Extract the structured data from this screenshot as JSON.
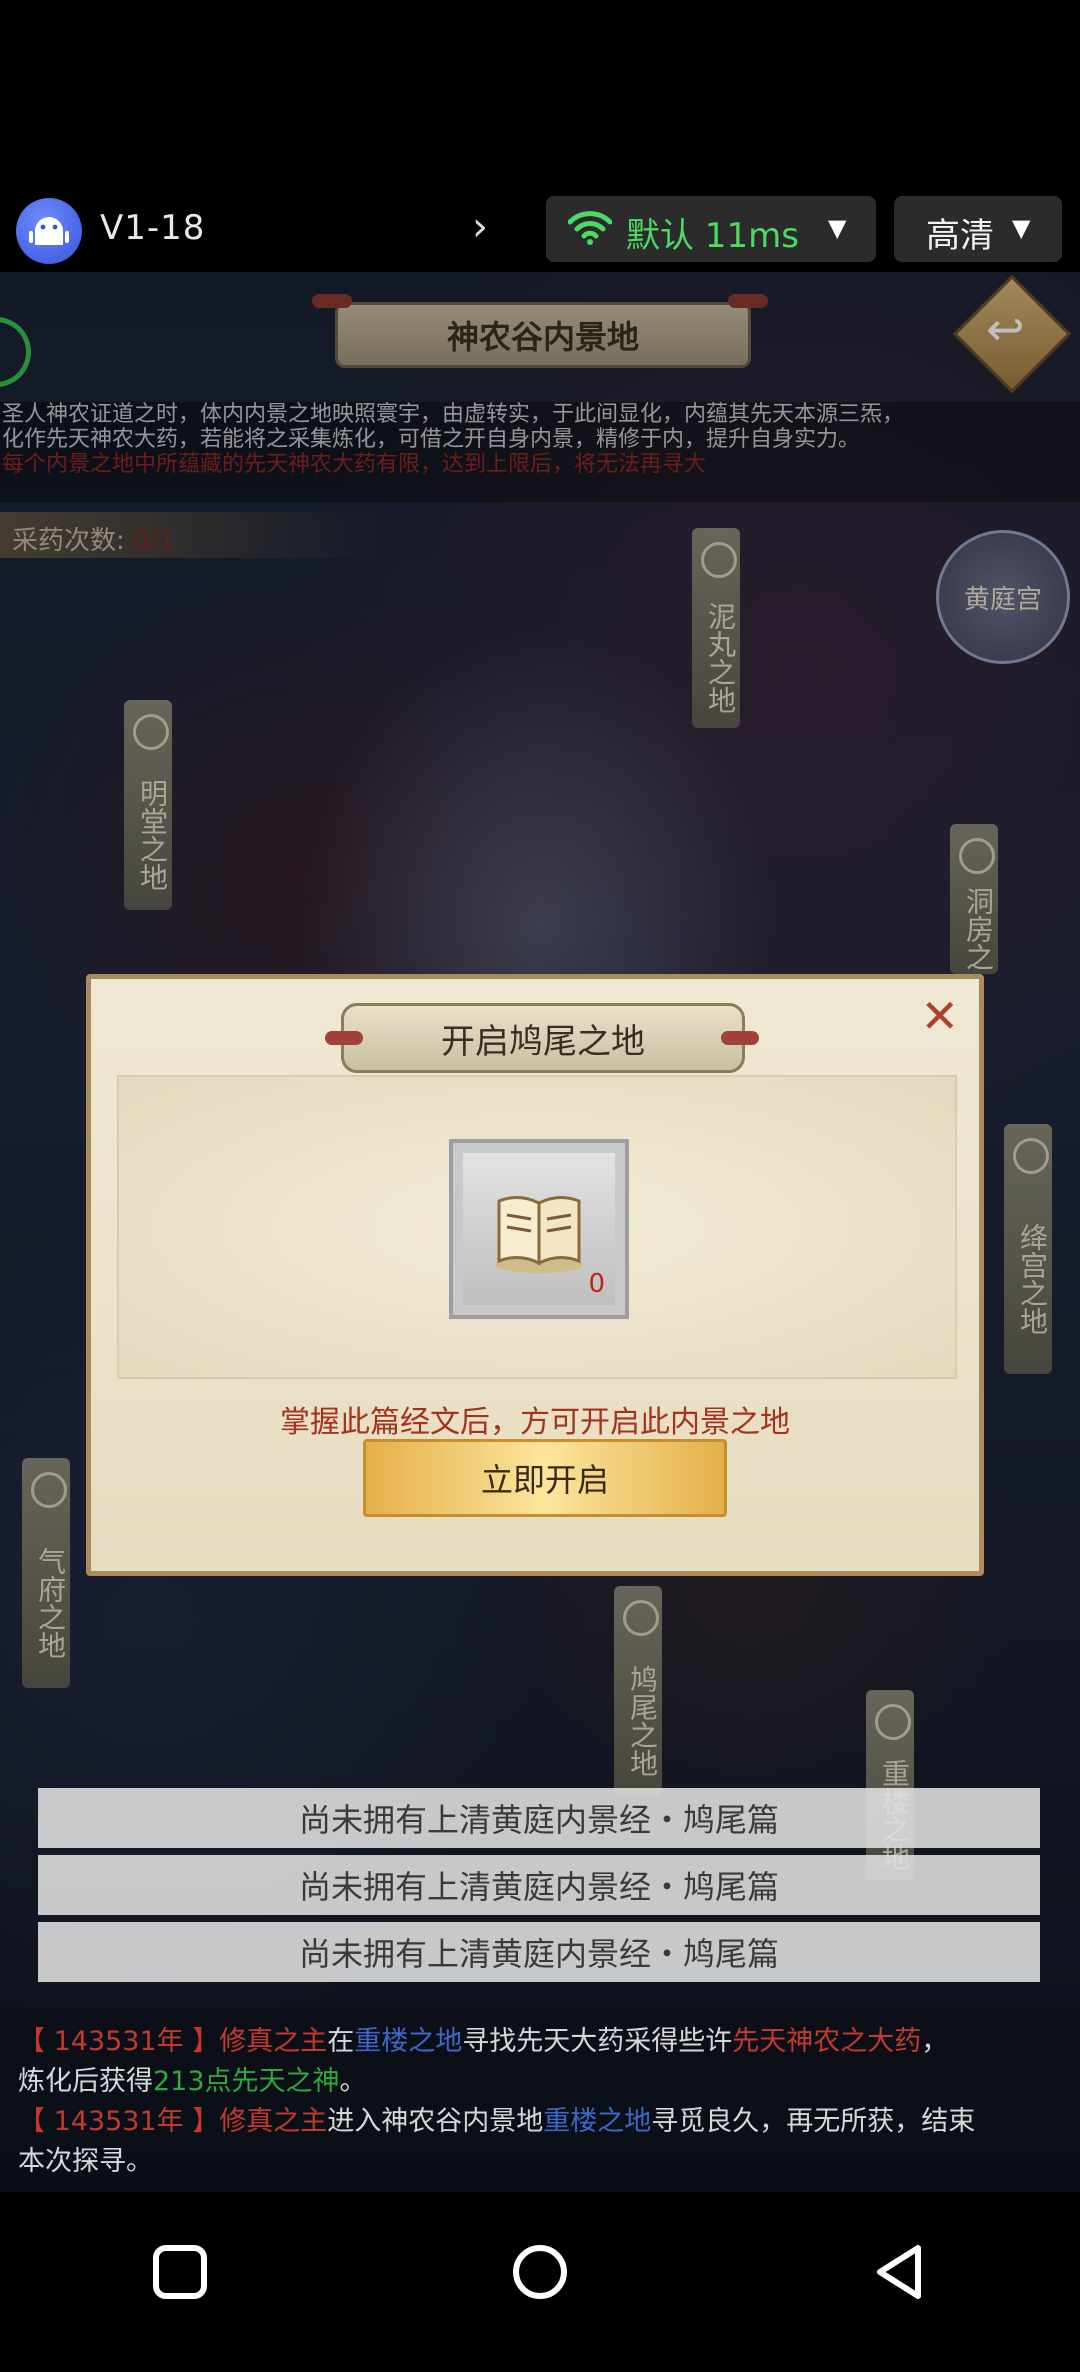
{
  "remote_bar": {
    "device_name": "V1-18",
    "network_label": "默认 11ms",
    "quality_label": "高清",
    "accent_green": "#4cd964"
  },
  "game": {
    "title": "神农谷内景地",
    "intro_lines": [
      "圣人神农证道之时，体内内景之地映照寰宇，由虚转实，于此间显化，内蕴其先天本源三炁，",
      "化作先天神农大药，若能将之采集炼化，可借之开自身内景，精修于内，提升自身实力。",
      "每个内景之地中所蕴藏的先天神农大药有限，达到上限后，将无法再寻大"
    ],
    "herb_count_label": "采药次数:",
    "herb_count_value": "0/1",
    "nodes": {
      "niwan": "泥丸之地",
      "huangting": "黄庭宫",
      "mingtang": "明堂之地",
      "dongfang": "洞房之",
      "jianggong": "绛宫之地",
      "qifu": "气府之地",
      "jiuwei": "鸠尾之地",
      "chonglou": "重楼之地"
    },
    "status_rows": [
      "尚未拥有上清黄庭内景经・鸠尾篇",
      "尚未拥有上清黄庭内景经・鸠尾篇",
      "尚未拥有上清黄庭内景经・鸠尾篇"
    ],
    "log": {
      "l1_year": "【 143531年 】",
      "l1_who": "修真之主",
      "l1_t1": "在",
      "l1_place": "重楼之地",
      "l1_t2": "寻找先天大药采得些许",
      "l1_item": "先天神农之大药",
      "l1_t3": "，",
      "l1_t4": "炼化后获得",
      "l1_gain": "213点先天之神",
      "l1_t5": "。",
      "l2_year": "【 143531年 】",
      "l2_who": "修真之主",
      "l2_t1": "进入神农谷内景地",
      "l2_place": "重楼之地",
      "l2_t2": "寻觅良久，再无所获，结束",
      "l2_t3": "本次探寻。"
    }
  },
  "dialog": {
    "title": "开启鸠尾之地",
    "item_count": "0",
    "hint": "掌握此篇经文后，方可开启此内景之地",
    "open_button": "立即开启"
  }
}
